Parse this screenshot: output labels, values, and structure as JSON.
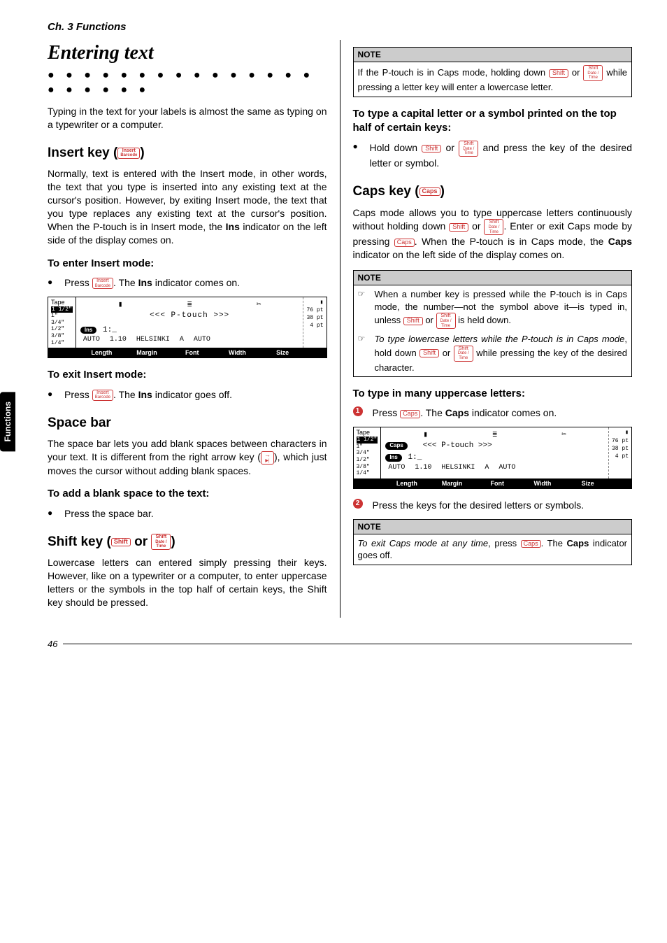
{
  "chapter": "Ch. 3 Functions",
  "sideTab": "Functions",
  "title": "Entering text",
  "intro": "Typing in the text for your labels is almost the same as typing on a typewriter or a computer.",
  "insert": {
    "heading": "Insert key (",
    "headingEnd": ")",
    "body": "Normally, text is entered with the Insert mode, in other words, the text that you type is inserted into any existing text at the cursor's position. However, by exiting Insert mode, the text that you type replaces any existing text at the cursor's position. When the P-touch is in Insert mode, the ",
    "bodyBold": "Ins",
    "body2": " indicator on the left side of the display comes on.",
    "enterHeading": "To enter Insert mode:",
    "enterStep1a": "Press ",
    "enterStep1b": ". The ",
    "enterStep1c": " indicator comes on.",
    "exitHeading": "To exit Insert mode:",
    "exitStep1a": "Press ",
    "exitStep1b": ". The ",
    "exitStep1c": " indicator goes off."
  },
  "keys": {
    "insert": "Insert",
    "insertSub": "Barcode",
    "shift": "Shift",
    "shiftStack": "Shift",
    "shiftStack2": "Date /",
    "shiftStack3": "Time",
    "caps": "Caps",
    "ins": "Ins"
  },
  "lcd": {
    "tapeHdr": "Tape",
    "tapes": [
      "1 1/2\"",
      "1\"",
      "3/4\"",
      "1/2\"",
      "3/8\"",
      "1/4\""
    ],
    "ptLabels": [
      "76",
      "38",
      "4"
    ],
    "ptUnit": "pt",
    "mainLine": "<<< P-touch >>>",
    "line2prefix": "1:",
    "status": [
      "AUTO",
      "1.10",
      "HELSINKI",
      "A",
      "AUTO"
    ],
    "labels": [
      "Length",
      "Margin",
      "Font",
      "Width",
      "Size"
    ],
    "insPill": "Ins",
    "capsPill": "Caps",
    "activeTape": "1 1/2\""
  },
  "space": {
    "heading": "Space bar",
    "body1": "The space bar lets you add blank spaces between characters in your text. It is different from the right arrow key (",
    "body2": "), which just moves the cursor without adding blank spaces.",
    "addHeading": "To add a blank space to the text:",
    "addStep": "Press the space bar."
  },
  "shift": {
    "heading1": "Shift key (",
    "headingOr": " or ",
    "heading2": ")",
    "body": "Lowercase letters can entered simply pressing their keys. However, like on a typewriter or a computer, to enter uppercase letters or the symbols in the top half of certain keys, the Shift key should be pressed."
  },
  "note1": {
    "hdr": "NOTE",
    "body1": "If the P-touch is in Caps mode, holding down ",
    "body2": " or ",
    "body3": " while pressing a letter key will enter a lowercase letter."
  },
  "capital": {
    "heading": "To type a capital letter or a symbol printed on the top half of certain keys:",
    "step1a": "Hold down ",
    "step1b": " or ",
    "step1c": " and press the key of the desired letter or symbol."
  },
  "caps": {
    "heading1": "Caps key (",
    "heading2": ")",
    "body1": "Caps mode allows you to type uppercase letters continuously without holding down ",
    "body2": " or ",
    "body3": ". Enter or exit Caps mode by pressing ",
    "body4": ". When the P-touch is in Caps mode, the ",
    "bodyBold": "Caps",
    "body5": " indicator on the left side of the display comes on."
  },
  "note2": {
    "hdr": "NOTE",
    "item1a": "When a number key is pressed while the P-touch is in Caps mode, the number—not the symbol above it—is typed in, unless ",
    "item1b": " or ",
    "item1c": " is held down.",
    "item2a": "To type lowercase letters while the P-touch is in Caps mode",
    "item2b": ", hold down ",
    "item2c": " or ",
    "item2d": " while pressing the key of the desired character."
  },
  "many": {
    "heading": "To type in many uppercase letters:",
    "step1a": "Press ",
    "step1b": ". The ",
    "step1bold": "Caps",
    "step1c": " indicator comes on.",
    "step2": "Press the keys for the desired letters or symbols."
  },
  "note3": {
    "hdr": "NOTE",
    "body1": "To exit Caps mode at any time",
    "body2": ", press ",
    "body3": ". The ",
    "bodyBold": "Caps",
    "body4": " indicator goes off."
  },
  "pageNum": "46",
  "arrowKey": {
    "top": "→",
    "bottom": "▶|"
  }
}
